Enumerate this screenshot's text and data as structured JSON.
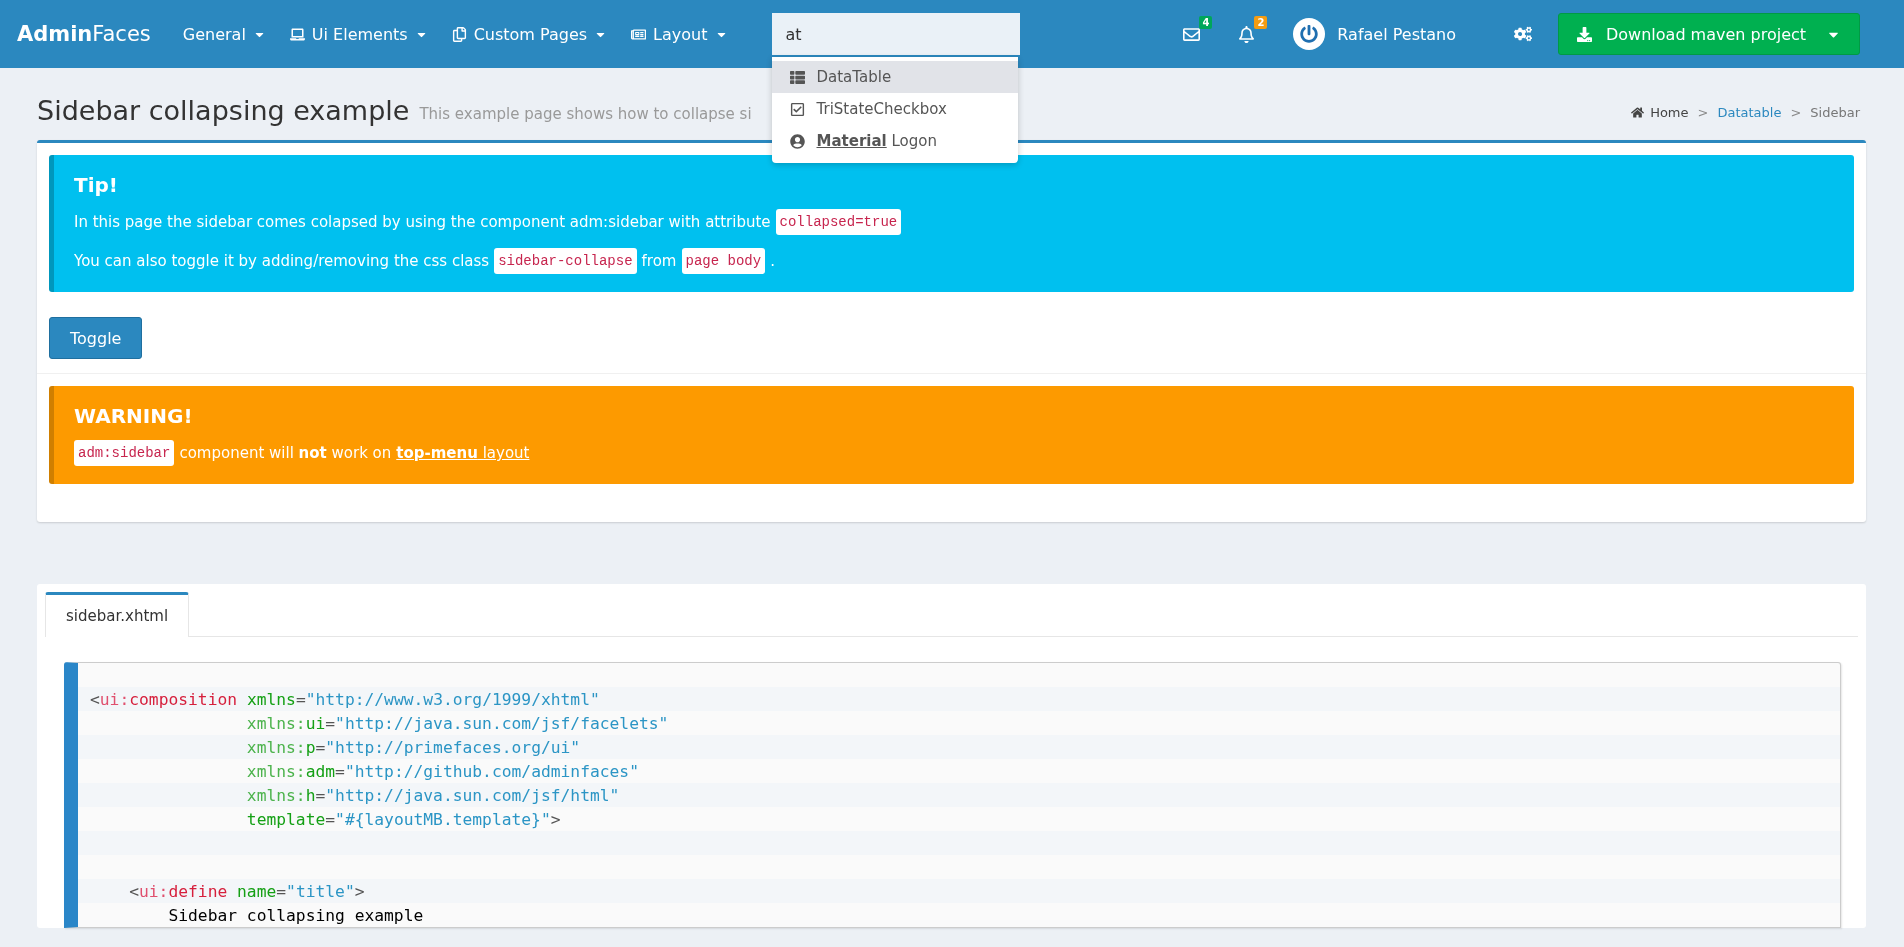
{
  "navbar": {
    "logo": "**Admin**Faces",
    "menus": [
      {
        "label": "General"
      },
      {
        "label": "Ui Elements"
      },
      {
        "label": "Custom Pages"
      },
      {
        "label": "Layout"
      }
    ],
    "search": {
      "value": "at",
      "suggestions": [
        {
          "label": "DataTable",
          "selected": true
        },
        {
          "label": "TriStateCheckbox",
          "selected": false
        },
        {
          "label": "**Material** Logon",
          "selected": false
        }
      ]
    },
    "messages_badge": "4",
    "notifications_badge": "2",
    "user": "Rafael Pestano",
    "download_button": "Download maven project"
  },
  "header": {
    "title": "Sidebar collapsing example",
    "subtitle": "This example page shows how to collapse si",
    "breadcrumb": [
      {
        "kind": "home",
        "label": "Home"
      },
      {
        "kind": "separator",
        "label": ">"
      },
      {
        "kind": "link",
        "label": "Datatable"
      },
      {
        "kind": "separator",
        "label": ">"
      },
      {
        "kind": "current",
        "label": "Sidebar"
      }
    ]
  },
  "tip": {
    "title": "Tip!",
    "paragraphs": [
      [
        {
          "kind": "text",
          "text": "In this page the sidebar comes colapsed by using the component adm:sidebar with attribute"
        },
        {
          "kind": "code",
          "text": "collapsed=true"
        }
      ],
      [
        {
          "kind": "text",
          "text": "You can also toggle it by adding/removing the css class"
        },
        {
          "kind": "code",
          "text": "sidebar-collapse"
        },
        {
          "kind": "text",
          "text": "from"
        },
        {
          "kind": "code",
          "text": "page body"
        },
        {
          "kind": "text",
          "text": "."
        }
      ]
    ]
  },
  "toggle_button": "Toggle",
  "warning": {
    "title": "WARNING!",
    "parts": [
      {
        "kind": "code",
        "text": "adm:sidebar"
      },
      {
        "kind": "text",
        "text": "component will **not** work on"
      },
      {
        "kind": "link",
        "text": "**top-menu** layout"
      }
    ]
  },
  "source": {
    "tabs": [
      {
        "label": "sidebar.xhtml",
        "selected": true
      }
    ],
    "lines": [
      {
        "kind": "code",
        "tokens": [
          {
            "kind": "punct",
            "text": "<"
          },
          {
            "kind": "ns",
            "text": "ui:"
          },
          {
            "kind": "tag",
            "text": "composition "
          },
          {
            "kind": "attr",
            "text": "xmlns"
          },
          {
            "kind": "punct",
            "text": "="
          },
          {
            "kind": "str",
            "text": "\"http://www.w3.org/1999/xhtml\""
          }
        ]
      },
      {
        "kind": "code",
        "tokens": [
          {
            "kind": "attrns",
            "text": "                xmlns:"
          },
          {
            "kind": "attr",
            "text": "ui"
          },
          {
            "kind": "punct",
            "text": "="
          },
          {
            "kind": "str",
            "text": "\"http://java.sun.com/jsf/facelets\""
          }
        ]
      },
      {
        "kind": "code",
        "tokens": [
          {
            "kind": "attrns",
            "text": "                xmlns:"
          },
          {
            "kind": "attr",
            "text": "p"
          },
          {
            "kind": "punct",
            "text": "="
          },
          {
            "kind": "str",
            "text": "\"http://primefaces.org/ui\""
          }
        ]
      },
      {
        "kind": "code",
        "tokens": [
          {
            "kind": "attrns",
            "text": "                xmlns:"
          },
          {
            "kind": "attr",
            "text": "adm"
          },
          {
            "kind": "punct",
            "text": "="
          },
          {
            "kind": "str",
            "text": "\"http://github.com/adminfaces\""
          }
        ]
      },
      {
        "kind": "code",
        "tokens": [
          {
            "kind": "attrns",
            "text": "                xmlns:"
          },
          {
            "kind": "attr",
            "text": "h"
          },
          {
            "kind": "punct",
            "text": "="
          },
          {
            "kind": "str",
            "text": "\"http://java.sun.com/jsf/html\""
          }
        ]
      },
      {
        "kind": "code",
        "tokens": [
          {
            "kind": "attr",
            "text": "                template"
          },
          {
            "kind": "punct",
            "text": "="
          },
          {
            "kind": "str",
            "text": "\"#{layoutMB.template}\""
          },
          {
            "kind": "punct",
            "text": ">"
          }
        ]
      },
      {
        "kind": "blank"
      },
      {
        "kind": "blank"
      },
      {
        "kind": "code",
        "tokens": [
          {
            "kind": "punct",
            "text": "    <"
          },
          {
            "kind": "ns",
            "text": "ui:"
          },
          {
            "kind": "tag",
            "text": "define "
          },
          {
            "kind": "attr",
            "text": "name"
          },
          {
            "kind": "punct",
            "text": "="
          },
          {
            "kind": "str",
            "text": "\"title\""
          },
          {
            "kind": "punct",
            "text": ">"
          }
        ]
      },
      {
        "kind": "code",
        "tokens": [
          {
            "kind": "text",
            "text": "        Sidebar collapsing example"
          }
        ]
      }
    ]
  }
}
